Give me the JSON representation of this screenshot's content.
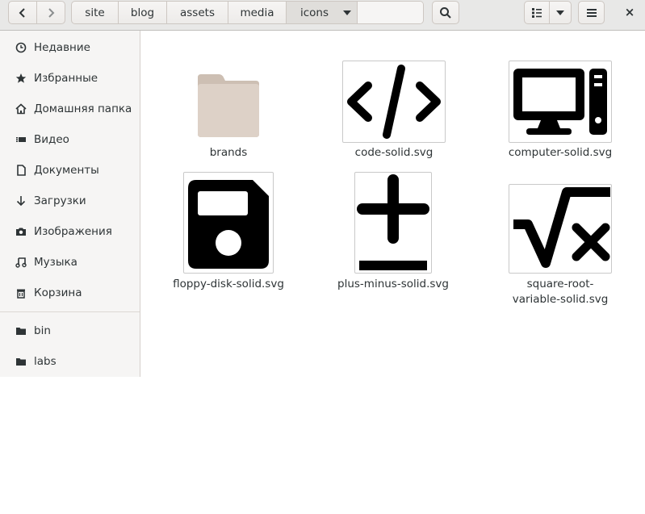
{
  "toolbar": {
    "back_icon": "chevron-left-icon",
    "forward_icon": "chevron-right-icon",
    "search_icon": "search-icon",
    "view_icon": "list-view-icon",
    "menu_icon": "hamburger-menu-icon",
    "close_glyph": "×"
  },
  "path": [
    "site",
    "blog",
    "assets",
    "media",
    "icons",
    ""
  ],
  "sidebar": {
    "items": [
      {
        "label": "Недавние",
        "icon": "clock-icon"
      },
      {
        "label": "Избранные",
        "icon": "star-icon"
      },
      {
        "label": "Домашняя папка",
        "icon": "home-icon"
      },
      {
        "label": "Видео",
        "icon": "video-icon"
      },
      {
        "label": "Документы",
        "icon": "document-icon"
      },
      {
        "label": "Загрузки",
        "icon": "download-icon"
      },
      {
        "label": "Изображения",
        "icon": "camera-icon"
      },
      {
        "label": "Музыка",
        "icon": "music-icon"
      },
      {
        "label": "Корзина",
        "icon": "trash-icon"
      }
    ],
    "bookmarks": [
      {
        "label": "bin",
        "icon": "folder-icon"
      },
      {
        "label": "labs",
        "icon": "folder-icon"
      }
    ]
  },
  "files": [
    {
      "name": "brands",
      "type": "folder"
    },
    {
      "name": "code-solid.svg",
      "type": "svg"
    },
    {
      "name": "computer-solid.svg",
      "type": "svg"
    },
    {
      "name": "floppy-disk-solid.svg",
      "type": "svg"
    },
    {
      "name": "plus-minus-solid.svg",
      "type": "svg"
    },
    {
      "name": "square-root-variable-solid.svg",
      "type": "svg",
      "label_lines": [
        "square-root-",
        "variable-solid.svg"
      ]
    }
  ],
  "colors": {
    "header_bg": "#e8e8e7",
    "sidebar_bg": "#f6f5f4",
    "folder": "#ddd1c7"
  }
}
